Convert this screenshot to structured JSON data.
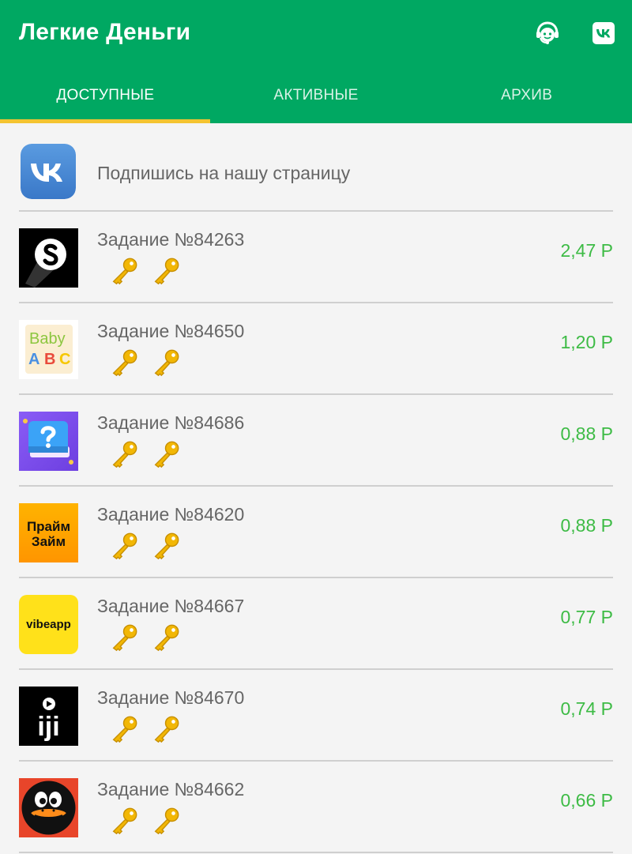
{
  "header": {
    "title": "Легкие Деньги",
    "support_icon": "support-agent-icon",
    "vk_icon": "vk-icon"
  },
  "tabs": [
    {
      "label": "ДОСТУПНЫЕ",
      "active": true
    },
    {
      "label": "АКТИВНЫЕ",
      "active": false
    },
    {
      "label": "АРХИВ",
      "active": false
    }
  ],
  "promo": {
    "label": "Подпишись на нашу страницу",
    "icon": "vk-logo-icon"
  },
  "tasks": [
    {
      "title": "Задание №84263",
      "price": "2,47 Р",
      "icon": "sleek-s-app-icon",
      "keys": 2
    },
    {
      "title": "Задание №84650",
      "price": "1,20 Р",
      "icon": "baby-abc-app-icon",
      "keys": 2,
      "icon_text": [
        "Baby",
        "A",
        "B",
        "C"
      ]
    },
    {
      "title": "Задание №84686",
      "price": "0,88 Р",
      "icon": "quiz-book-app-icon",
      "keys": 2
    },
    {
      "title": "Задание №84620",
      "price": "0,88 Р",
      "icon": "prime-zaim-app-icon",
      "keys": 2,
      "icon_text": [
        "Прайм",
        "Займ"
      ]
    },
    {
      "title": "Задание №84667",
      "price": "0,77 Р",
      "icon": "vibeapp-app-icon",
      "keys": 2,
      "icon_text": [
        "vibeapp"
      ]
    },
    {
      "title": "Задание №84670",
      "price": "0,74 Р",
      "icon": "iji-app-icon",
      "keys": 2,
      "icon_text": [
        "iji"
      ]
    },
    {
      "title": "Задание №84662",
      "price": "0,66 Р",
      "icon": "duck-app-icon",
      "keys": 2
    }
  ],
  "colors": {
    "appbar": "#00a862",
    "tab_indicator": "#f4c430",
    "price": "#3dbb45",
    "key": "#f2b705"
  }
}
